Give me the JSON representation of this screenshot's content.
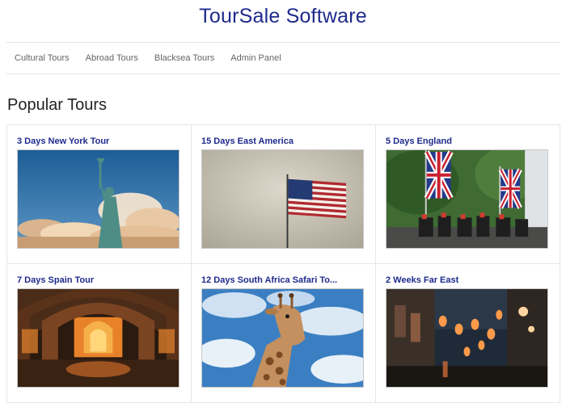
{
  "site": {
    "title": "TourSale Software"
  },
  "nav": {
    "items": [
      {
        "label": "Cultural Tours"
      },
      {
        "label": "Abroad Tours"
      },
      {
        "label": "Blacksea Tours"
      },
      {
        "label": "Admin Panel"
      }
    ]
  },
  "section": {
    "title": "Popular Tours"
  },
  "tours": [
    {
      "title": "3 Days New York Tour",
      "image": "statue-of-liberty-photo"
    },
    {
      "title": "15 Days East America",
      "image": "american-flag-photo"
    },
    {
      "title": "5 Days England",
      "image": "union-jack-parade-photo"
    },
    {
      "title": "7 Days Spain Tour",
      "image": "arched-hall-photo"
    },
    {
      "title": "12 Days South Africa Safari To...",
      "image": "giraffe-photo"
    },
    {
      "title": "2 Weeks Far East",
      "image": "lantern-street-photo"
    }
  ]
}
